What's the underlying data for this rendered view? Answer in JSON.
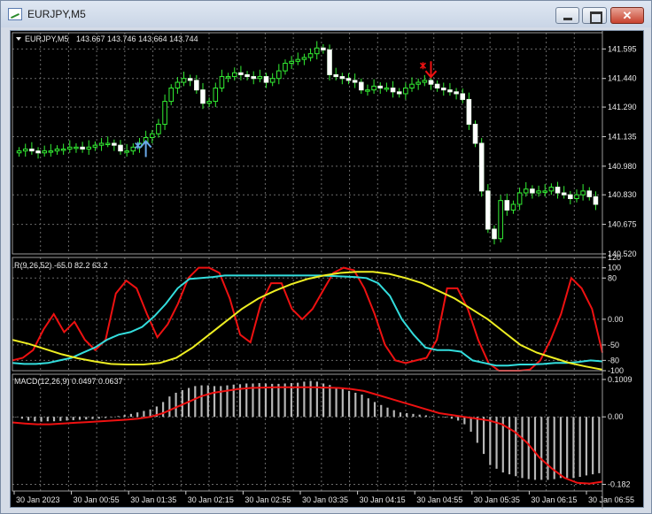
{
  "window": {
    "title": "EURJPY,M5"
  },
  "title_buttons": {
    "close": "✕"
  },
  "chart_data": [
    {
      "type": "candlestick",
      "title": "EURJPY,M5",
      "ohlc_text": "143.667 143.746 143.664 143.744",
      "ylim": [
        140.52,
        141.68
      ],
      "y_ticks": [
        141.595,
        141.44,
        141.29,
        141.135,
        140.98,
        140.83,
        140.675,
        140.52
      ],
      "y_tick_labels": [
        "141.595",
        "141.440",
        "141.290",
        "141.135",
        "140.980",
        "140.830",
        "140.675",
        "140.520"
      ],
      "closes": [
        141.06,
        141.07,
        141.06,
        141.05,
        141.06,
        141.06,
        141.07,
        141.07,
        141.08,
        141.08,
        141.07,
        141.08,
        141.09,
        141.1,
        141.1,
        141.09,
        141.06,
        141.06,
        141.08,
        141.1,
        141.13,
        141.15,
        141.2,
        141.32,
        141.39,
        141.42,
        141.44,
        141.43,
        141.38,
        141.31,
        141.32,
        141.39,
        141.45,
        141.45,
        141.47,
        141.46,
        141.45,
        141.44,
        141.45,
        141.42,
        141.44,
        141.48,
        141.52,
        141.53,
        141.54,
        141.55,
        141.57,
        141.6,
        141.59,
        141.46,
        141.45,
        141.44,
        141.43,
        141.42,
        141.38,
        141.38,
        141.4,
        141.39,
        141.39,
        141.37,
        141.36,
        141.39,
        141.41,
        141.42,
        141.43,
        141.41,
        141.39,
        141.38,
        141.37,
        141.36,
        141.33,
        141.2,
        141.1,
        140.85,
        140.65,
        140.6,
        140.8,
        140.75,
        140.78,
        140.84,
        140.86,
        140.84,
        140.85,
        140.85,
        140.87,
        140.84,
        140.83,
        140.81,
        140.83,
        140.85,
        140.82,
        140.78
      ],
      "signals": [
        {
          "type": "buy",
          "index": 20,
          "color": "#6aa8e8"
        },
        {
          "type": "sell",
          "index": 65,
          "color": "#ee1111"
        }
      ]
    },
    {
      "type": "line",
      "title": "R(9,26,52) -65.0 82.2 63.2",
      "ylim": [
        -100,
        120
      ],
      "y_ticks": [
        120,
        100,
        80,
        0,
        -50,
        -80,
        -100
      ],
      "y_tick_labels": [
        "120",
        "100",
        "80",
        "0.00",
        "-50",
        "-80",
        "-100"
      ],
      "series": [
        {
          "color": "#ee1111",
          "values": [
            -80,
            -75,
            -60,
            -20,
            10,
            -25,
            -5,
            -40,
            -60,
            -40,
            50,
            75,
            60,
            10,
            -35,
            -10,
            30,
            80,
            100,
            100,
            90,
            40,
            -30,
            -45,
            30,
            70,
            70,
            20,
            0,
            20,
            55,
            90,
            100,
            95,
            60,
            10,
            -50,
            -80,
            -85,
            -80,
            -75,
            -40,
            60,
            60,
            20,
            -40,
            -85,
            -100,
            -100,
            -100,
            -98,
            -80,
            -40,
            10,
            80,
            60,
            20,
            -65
          ]
        },
        {
          "color": "#33dddd",
          "values": [
            -85,
            -87,
            -87,
            -85,
            -80,
            -75,
            -65,
            -55,
            -40,
            -30,
            -25,
            -15,
            5,
            30,
            60,
            78,
            80,
            82,
            85,
            85,
            85,
            85,
            85,
            85,
            85,
            85,
            85,
            84,
            83,
            82,
            80,
            70,
            45,
            0,
            -30,
            -55,
            -60,
            -60,
            -63,
            -80,
            -85,
            -90,
            -90,
            -88,
            -88,
            -87,
            -85,
            -85,
            -83,
            -80,
            -82
          ]
        },
        {
          "color": "#eeee22",
          "values": [
            -40,
            -48,
            -58,
            -68,
            -76,
            -82,
            -87,
            -88,
            -88,
            -85,
            -75,
            -55,
            -30,
            -5,
            20,
            40,
            55,
            68,
            78,
            85,
            90,
            92,
            92,
            88,
            80,
            70,
            55,
            40,
            20,
            0,
            -25,
            -50,
            -65,
            -75,
            -85,
            -92,
            -98
          ]
        }
      ]
    },
    {
      "type": "bar",
      "title": "MACD(12,26,9) 0.0497 0.0637",
      "ylim": [
        -0.2,
        0.115
      ],
      "y_ticks": [
        0.1009,
        0.0,
        -0.182
      ],
      "y_tick_labels": [
        "0.1009",
        "0.00",
        "-0.182"
      ],
      "values": [
        0.0,
        -0.005,
        -0.01,
        -0.012,
        -0.013,
        -0.012,
        -0.012,
        -0.011,
        -0.01,
        -0.009,
        -0.008,
        -0.007,
        -0.006,
        -0.005,
        -0.003,
        -0.001,
        0.002,
        0.005,
        0.008,
        0.012,
        0.016,
        0.02,
        0.028,
        0.04,
        0.055,
        0.065,
        0.072,
        0.078,
        0.083,
        0.085,
        0.085,
        0.083,
        0.083,
        0.085,
        0.087,
        0.088,
        0.09,
        0.09,
        0.091,
        0.09,
        0.089,
        0.089,
        0.09,
        0.091,
        0.092,
        0.095,
        0.097,
        0.095,
        0.09,
        0.086,
        0.08,
        0.075,
        0.07,
        0.065,
        0.06,
        0.05,
        0.04,
        0.032,
        0.025,
        0.018,
        0.012,
        0.01,
        0.008,
        0.006,
        0.004,
        0.002,
        0.0,
        -0.002,
        -0.005,
        -0.01,
        -0.02,
        -0.04,
        -0.07,
        -0.1,
        -0.13,
        -0.14,
        -0.15,
        -0.155,
        -0.16,
        -0.165,
        -0.168,
        -0.17,
        -0.17,
        -0.17,
        -0.168,
        -0.165,
        -0.165,
        -0.165,
        -0.162,
        -0.158,
        -0.155,
        -0.152
      ],
      "signal_values": [
        -0.015,
        -0.018,
        -0.02,
        -0.02,
        -0.018,
        -0.016,
        -0.014,
        -0.012,
        -0.01,
        -0.008,
        -0.005,
        0.0,
        0.01,
        0.025,
        0.04,
        0.055,
        0.065,
        0.07,
        0.075,
        0.078,
        0.079,
        0.08,
        0.08,
        0.08,
        0.08,
        0.079,
        0.078,
        0.075,
        0.07,
        0.06,
        0.05,
        0.04,
        0.03,
        0.02,
        0.01,
        0.005,
        0.0,
        -0.005,
        -0.01,
        -0.02,
        -0.04,
        -0.07,
        -0.11,
        -0.14,
        -0.165,
        -0.178,
        -0.18,
        -0.175
      ],
      "bar_color": "#b8b8b8",
      "signal_color": "#ee1111"
    }
  ],
  "time_axis": [
    "30 Jan 2023",
    "30 Jan 00:55",
    "30 Jan 01:35",
    "30 Jan 02:15",
    "30 Jan 02:55",
    "30 Jan 03:35",
    "30 Jan 04:15",
    "30 Jan 04:55",
    "30 Jan 05:35",
    "30 Jan 06:15",
    "30 Jan 06:55"
  ]
}
